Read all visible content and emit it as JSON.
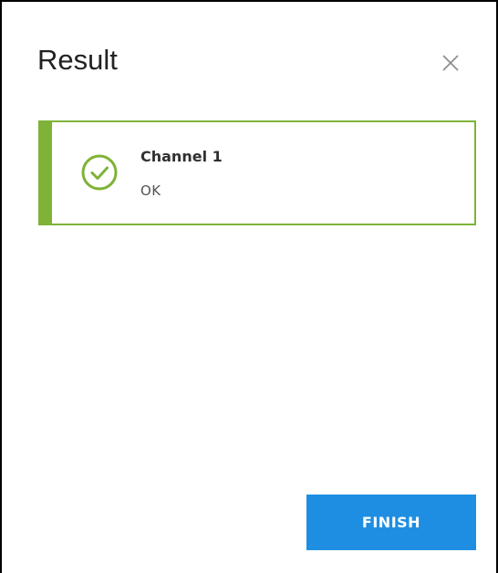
{
  "dialog": {
    "title": "Result",
    "close_icon": "close-icon"
  },
  "result_card": {
    "channel_label": "Channel 1",
    "status": "OK",
    "status_icon": "check-circle-icon",
    "accent_color": "#7eb338"
  },
  "actions": {
    "finish_label": "FINISH",
    "finish_color": "#1e8ee2"
  }
}
